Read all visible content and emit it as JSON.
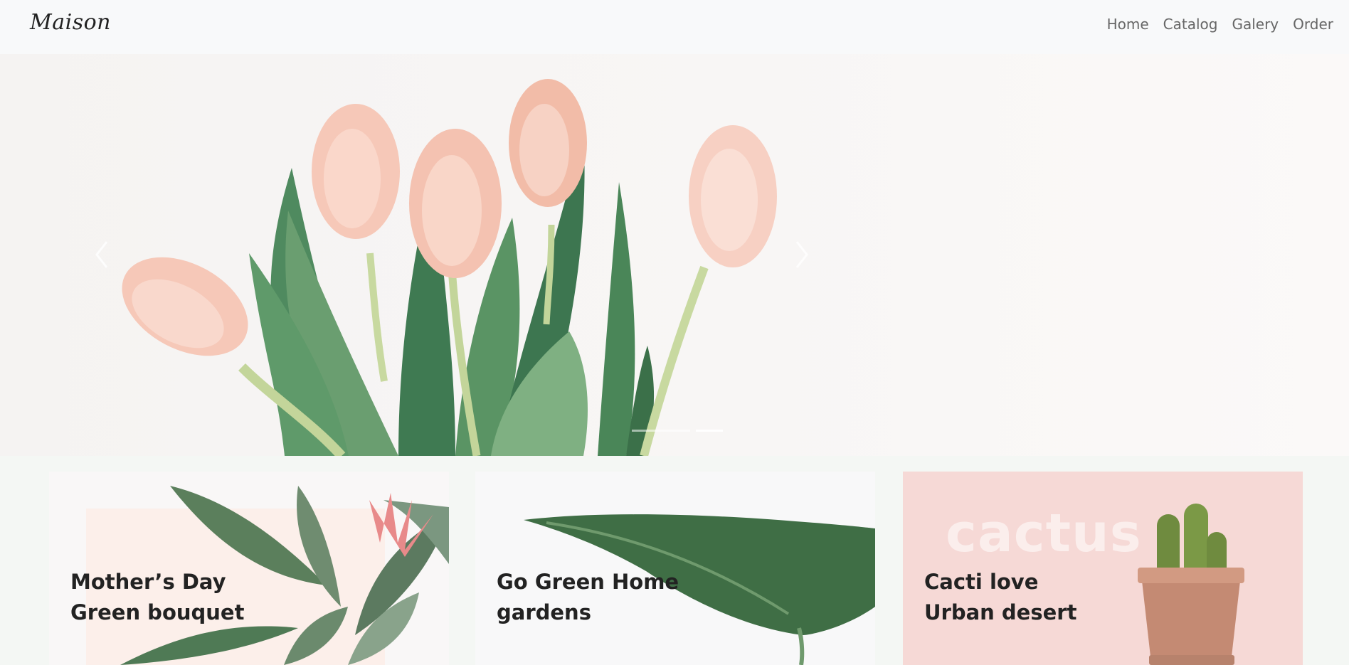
{
  "header": {
    "logo": "Maison",
    "nav": [
      "Home",
      "Catalog",
      "Galery",
      "Order"
    ]
  },
  "hero": {
    "image": "pink-tulips-bouquet",
    "prev_icon": "chevron-left-icon",
    "next_icon": "chevron-right-icon",
    "indicators": 2,
    "active_indicator": 2
  },
  "cards": [
    {
      "title": "Mother’s Day\nGreen bouquet",
      "image": "bromeliad-plant"
    },
    {
      "title": "Go Green  Home\ngardens",
      "image": "tropical-leaf"
    },
    {
      "title": "Cacti love\nUrban desert",
      "watermark": "cactus",
      "image": "potted-cactus"
    }
  ],
  "colors": {
    "header_bg": "#f8f9fa",
    "page_bg": "#f4f7f4",
    "card3_bg": "#f6d9d6",
    "text": "#222222",
    "nav_text": "#666666"
  }
}
